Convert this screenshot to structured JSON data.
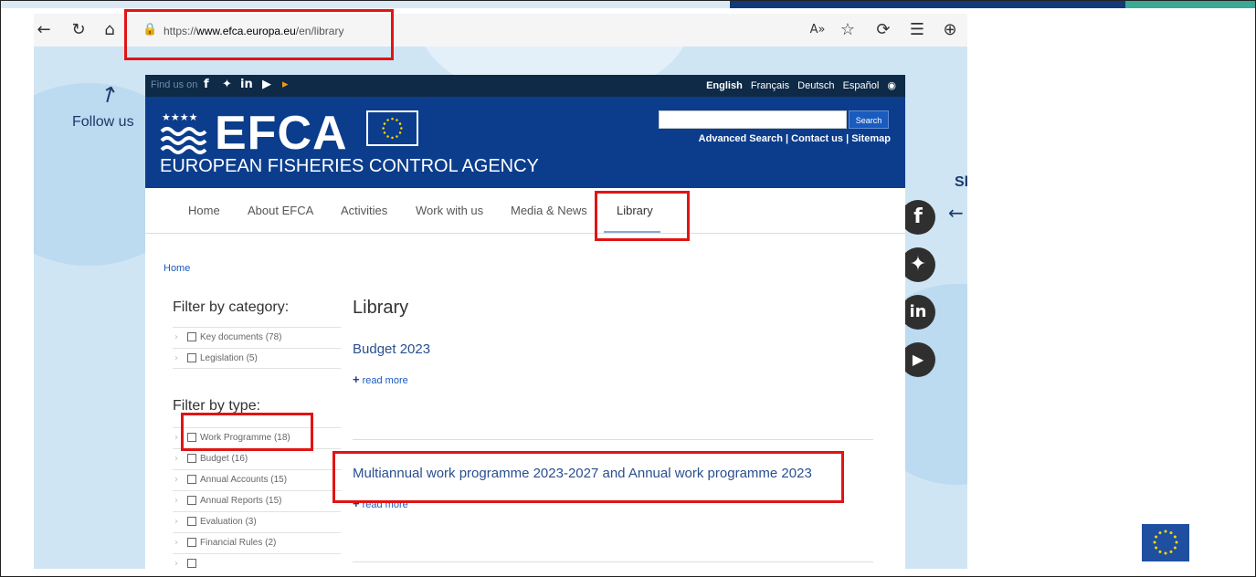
{
  "browser": {
    "url_prefix": "https://",
    "url_domain": "www.efca.europa.eu",
    "url_path": "/en/library",
    "icons": [
      "back-icon",
      "refresh-icon",
      "home-icon",
      "lock-icon",
      "read-aloud-icon",
      "favorite-icon",
      "extensions-icon",
      "favorites-bar-icon",
      "collections-icon"
    ]
  },
  "backdrop": {
    "follow_us": "Follow us",
    "share_partial": "Sl"
  },
  "site": {
    "find_us": "Find us on",
    "languages": [
      "English",
      "Français",
      "Deutsch",
      "Español"
    ],
    "logo_text": "EFCA",
    "agency_name": "EUROPEAN FISHERIES CONTROL AGENCY",
    "search_button": "Search",
    "header_links": "Advanced Search | Contact us | Sitemap",
    "nav": [
      "Home",
      "About EFCA",
      "Activities",
      "Work with us",
      "Media & News",
      "Library"
    ],
    "breadcrumb": "Home",
    "filter_category_heading": "Filter by category:",
    "filter_categories": [
      "Key documents (78)",
      "Legislation (5)"
    ],
    "filter_type_heading": "Filter by type:",
    "filter_types": [
      "Work Programme (18)",
      "Budget (16)",
      "Annual Accounts (15)",
      "Annual Reports (15)",
      "Evaluation (3)",
      "Financial Rules (2)"
    ],
    "main_title": "Library",
    "items": [
      {
        "title": "Budget 2023",
        "read_more": "read more"
      },
      {
        "title": "Multiannual work programme 2023-2027 and Annual work programme 2023",
        "read_more": "read more"
      }
    ]
  },
  "colors": {
    "highlight": "#e11414",
    "header_blue": "#0b3d8c",
    "top_strip": "#0e2a47"
  }
}
